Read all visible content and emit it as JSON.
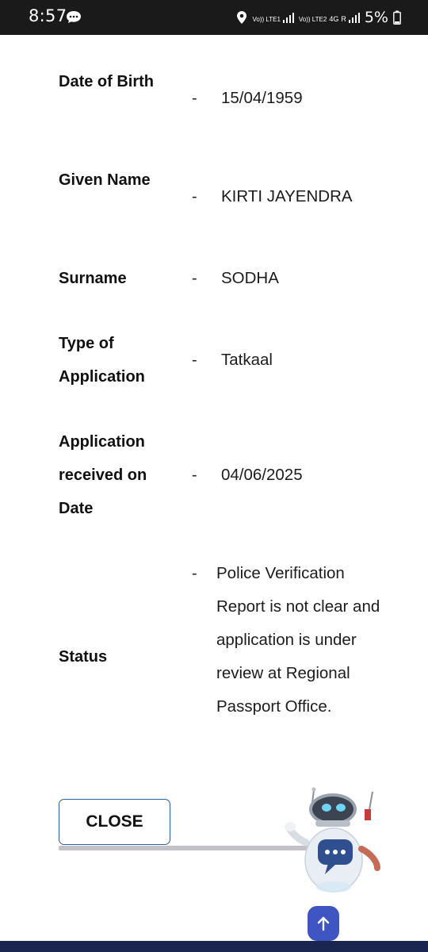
{
  "status_bar": {
    "time": "8:57",
    "network_1": "Vo)) LTE1",
    "network_2": "Vo)) LTE2",
    "network_type": "4G",
    "roaming": "R",
    "battery": "5%"
  },
  "rows": [
    {
      "label": "Date of Birth",
      "separator": "-",
      "value": "15/04/1959"
    },
    {
      "label": "Given Name",
      "separator": "-",
      "value": "KIRTI JAYENDRA"
    },
    {
      "label": "Surname",
      "separator": "-",
      "value": "SODHA"
    },
    {
      "label": "Type of Application",
      "separator": "-",
      "value": "Tatkaal"
    },
    {
      "label": "Application received on Date",
      "separator": "-",
      "value": "04/06/2025"
    },
    {
      "label": "Status",
      "separator": "-",
      "value": "Police Verification Report is not clear and application is under review at Regional Passport Office."
    }
  ],
  "close_button": "CLOSE",
  "icons": {
    "chatbot": "chatbot-robot-icon",
    "scroll_top": "arrow-up-icon",
    "location": "location-icon",
    "message": "message-icon"
  },
  "colors": {
    "accent": "#3f56c2",
    "button_border": "#2b5d9a",
    "bottom_bar": "#1a2550"
  }
}
